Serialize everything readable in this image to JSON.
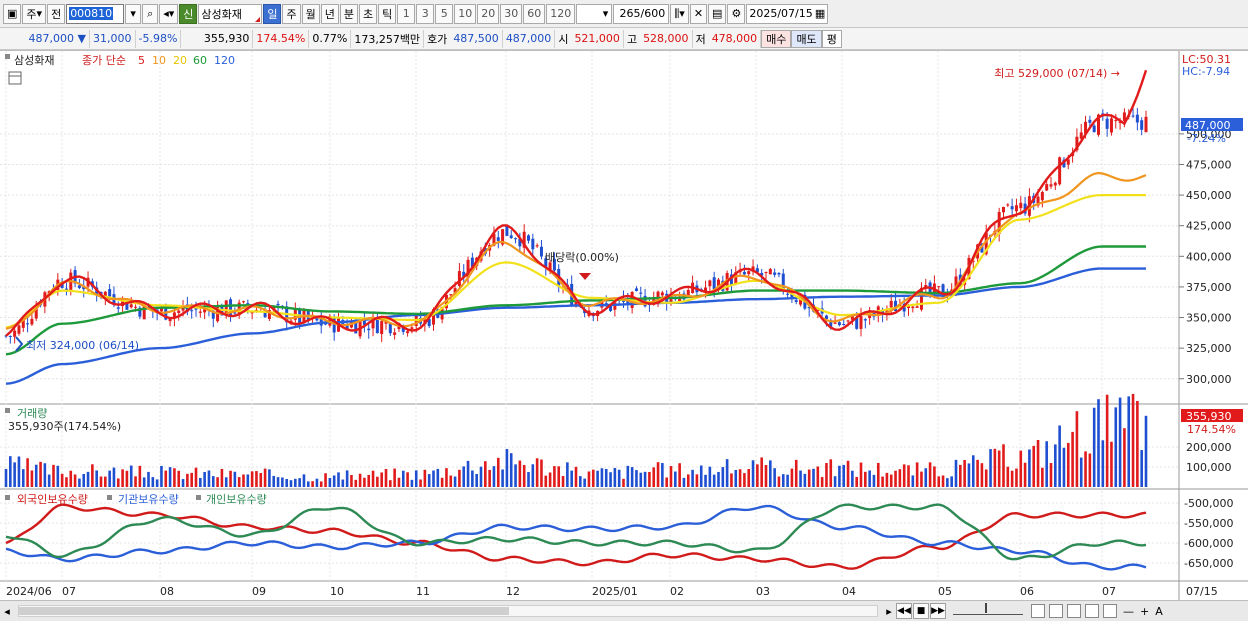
{
  "toolbar": {
    "period_main": "주",
    "prev_label": "전",
    "code": "000810",
    "stock_name": "삼성화재",
    "shin_label": "신",
    "periods": [
      "일",
      "주",
      "월",
      "년",
      "분",
      "초",
      "틱"
    ],
    "active_period": "일",
    "intervals": [
      "1",
      "3",
      "5",
      "10",
      "20",
      "30",
      "60",
      "120"
    ],
    "count": "265",
    "count_max": "/600",
    "date": "2025/07/15"
  },
  "quote": {
    "price": "487,000",
    "change": "31,000",
    "change_pct": "-5.98%",
    "volume": "355,930",
    "volume_ratio": "174.54%",
    "turnover_pct": "0.77%",
    "amount": "173,257백만",
    "ask_label": "호가",
    "ask": "487,500",
    "bid": "487,000",
    "open_label": "시",
    "open": "521,000",
    "high_label": "고",
    "high": "528,000",
    "low_label": "저",
    "low": "478,000",
    "buy_label": "매수",
    "sell_label": "매도",
    "eval_label": "평"
  },
  "price_pane": {
    "title": "삼성화재",
    "ma_label": "종가 단순",
    "ma_periods": [
      {
        "label": "5",
        "color": "#e11b1b"
      },
      {
        "label": "10",
        "color": "#f0951e"
      },
      {
        "label": "20",
        "color": "#f2e11a"
      },
      {
        "label": "60",
        "color": "#1e9a3a"
      },
      {
        "label": "120",
        "color": "#2b5fd9"
      }
    ],
    "yticks": [
      "500,000",
      "475,000",
      "450,000",
      "425,000",
      "400,000",
      "375,000",
      "350,000",
      "325,000",
      "300,000"
    ],
    "yvals": [
      500000,
      475000,
      450000,
      425000,
      400000,
      375000,
      350000,
      325000,
      300000
    ],
    "lc_label": "LC:50.31",
    "hc_label": "HC:-7.94",
    "price_tag": "487,000",
    "price_tag_pct": "-7.24%",
    "high_note": "최고 529,000 (07/14) →",
    "low_note": "최저 324,000 (06/14)",
    "dividend_note": "배당락(0.00%)"
  },
  "volume_pane": {
    "title": "거래량",
    "subtitle": "355,930주(174.54%)",
    "yticks": [
      "200,000",
      "100,000"
    ],
    "yvals": [
      200000,
      100000
    ],
    "tag": "355,930",
    "tag_pct": "174.54%"
  },
  "holdings_pane": {
    "legend": [
      {
        "label": "외국인보유수량",
        "color": "#d11b1b"
      },
      {
        "label": "기관보유수량",
        "color": "#2b5fd9"
      },
      {
        "label": "개인보유수량",
        "color": "#2e8a55"
      }
    ],
    "yticks": [
      "-500,000",
      "-550,000",
      "-600,000",
      "-650,000"
    ],
    "yvals": [
      -500000,
      -550000,
      -600000,
      -650000
    ]
  },
  "xaxis": {
    "labels": [
      "2024/06",
      "07",
      "08",
      "09",
      "10",
      "11",
      "12",
      "2025/01",
      "02",
      "03",
      "04",
      "05",
      "06",
      "07"
    ],
    "right_label": "07/15"
  },
  "colors": {
    "up": "#e11b1b",
    "down": "#1f4fd1",
    "ma5": "#e11b1b",
    "ma10": "#f0951e",
    "ma20": "#f2e11a",
    "ma60": "#1e9a3a",
    "ma120": "#2b5fd9"
  },
  "chart_data": {
    "type": "line",
    "x": [
      "2024/06",
      "07",
      "08",
      "09",
      "10",
      "11",
      "12",
      "2025/01",
      "02",
      "03",
      "04",
      "05",
      "06",
      "07"
    ],
    "series": [
      {
        "name": "5",
        "values": [
          335000,
          380000,
          355000,
          357000,
          345000,
          345000,
          420000,
          358000,
          368000,
          385000,
          345000,
          370000,
          440000,
          510000
        ]
      },
      {
        "name": "10",
        "values": [
          338000,
          377000,
          357000,
          356000,
          347000,
          346000,
          410000,
          362000,
          365000,
          383000,
          348000,
          368000,
          436000,
          465000
        ]
      },
      {
        "name": "20",
        "values": [
          342000,
          372000,
          360000,
          355000,
          350000,
          348000,
          395000,
          366000,
          362000,
          380000,
          352000,
          362000,
          430000,
          450000
        ]
      },
      {
        "name": "60",
        "values": [
          320000,
          345000,
          358000,
          360000,
          355000,
          353000,
          360000,
          364000,
          366000,
          372000,
          372000,
          370000,
          378000,
          408000
        ]
      },
      {
        "name": "120",
        "values": [
          296000,
          312000,
          325000,
          337000,
          346000,
          352000,
          358000,
          360000,
          362000,
          365000,
          367000,
          368000,
          375000,
          390000
        ]
      }
    ],
    "volume": [
      120000,
      90000,
      80000,
      70000,
      60000,
      75000,
      150000,
      80000,
      95000,
      110000,
      105000,
      95000,
      170000,
      355930
    ],
    "holdings": [
      {
        "name": "외국인보유수량",
        "values": [
          -600000,
          -510000,
          -530000,
          -560000,
          -570000,
          -600000,
          -640000,
          -650000,
          -630000,
          -640000,
          -660000,
          -610000,
          -530000,
          -530000
        ]
      },
      {
        "name": "기관보유수량",
        "values": [
          -620000,
          -640000,
          -620000,
          -600000,
          -610000,
          -600000,
          -560000,
          -565000,
          -560000,
          -510000,
          -560000,
          -600000,
          -620000,
          -660000
        ]
      },
      {
        "name": "개인보유수량",
        "values": [
          -580000,
          -630000,
          -540000,
          -580000,
          -510000,
          -600000,
          -590000,
          -600000,
          -600000,
          -620000,
          -510000,
          -510000,
          -640000,
          -600000
        ]
      }
    ],
    "ylim": [
      290000,
      535000
    ]
  }
}
